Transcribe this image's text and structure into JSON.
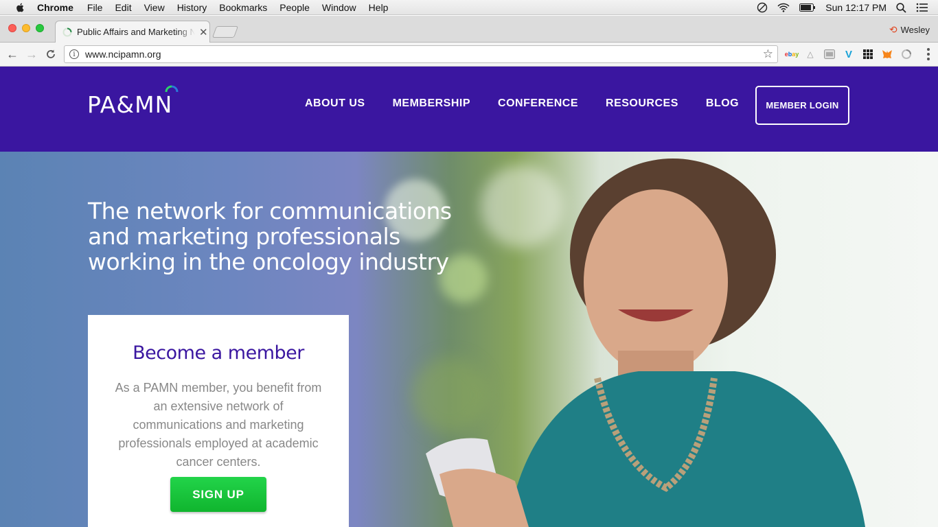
{
  "os_menubar": {
    "app_name": "Chrome",
    "items": [
      "File",
      "Edit",
      "View",
      "History",
      "Bookmarks",
      "People",
      "Window",
      "Help"
    ],
    "clock": "Sun 12:17 PM"
  },
  "browser": {
    "tab_title": "Public Affairs and Marketing Network",
    "profile_name": "Wesley",
    "url": "www.ncipamn.org",
    "extensions": [
      "ebay-icon",
      "translate-icon",
      "vpn-icon",
      "vimeo-icon",
      "grid-icon",
      "metamask-icon",
      "sync-icon"
    ]
  },
  "site": {
    "logo_text": "PA&MN",
    "nav": [
      "ABOUT US",
      "MEMBERSHIP",
      "CONFERENCE",
      "RESOURCES",
      "BLOG"
    ],
    "login_label": "MEMBER LOGIN",
    "hero_headline": "The network for communications and marketing professionals working in the oncology industry",
    "card": {
      "title": "Become a member",
      "body": "As a PAMN member, you benefit from an extensive network of communications and marketing professionals employed at academic cancer centers.",
      "button": "SIGN UP"
    }
  },
  "colors": {
    "brand_purple": "#3a16a0",
    "signup_green": "#16c13a"
  }
}
